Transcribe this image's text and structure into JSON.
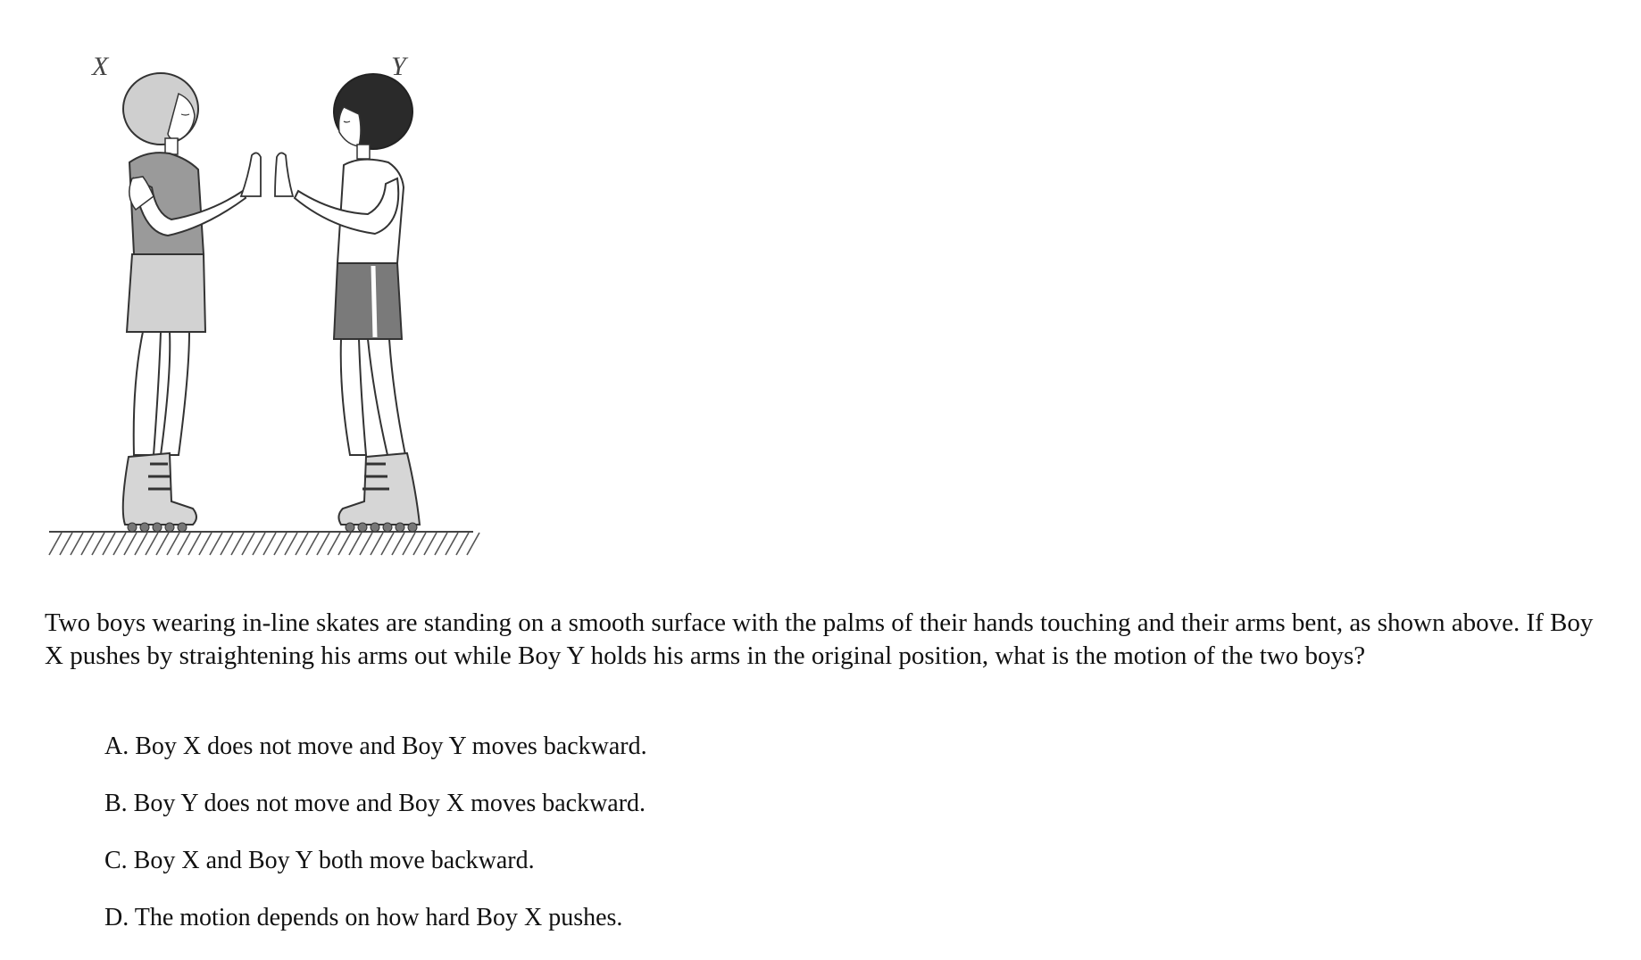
{
  "figure": {
    "label_x": "X",
    "label_y": "Y"
  },
  "question": {
    "text": "Two boys wearing in-line skates are standing on a smooth surface with the palms of their hands touching and their arms bent, as shown above. If Boy X pushes by straightening his arms out while Boy Y holds his arms in the original position, what is the motion of the two boys?"
  },
  "choices": [
    {
      "text": "A. Boy X does not move and Boy Y moves backward."
    },
    {
      "text": "B. Boy Y does not move and Boy X moves backward."
    },
    {
      "text": "C. Boy X and Boy Y both move backward."
    },
    {
      "text": "D. The motion depends on how hard Boy X pushes."
    }
  ]
}
